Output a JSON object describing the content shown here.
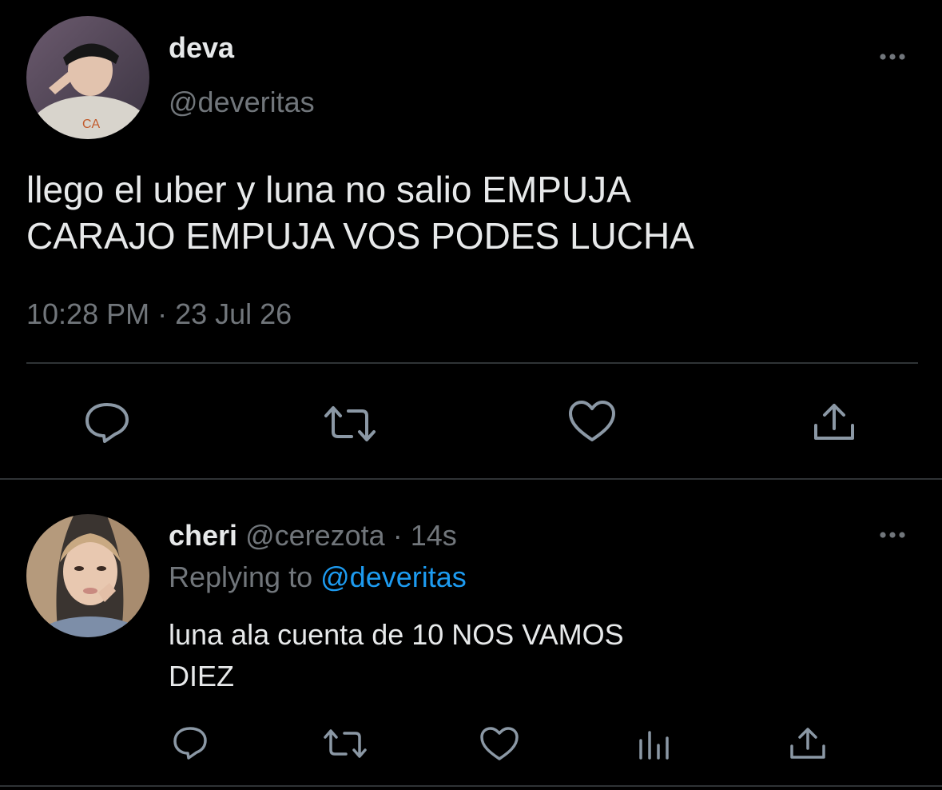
{
  "main_tweet": {
    "display_name": "deva",
    "handle": "@deveritas",
    "text_line1": "llego el uber y luna no salio EMPUJA",
    "text_line2": "CARAJO EMPUJA VOS PODES LUCHA",
    "timestamp": "10:28 PM · 23 Jul 26",
    "actions": [
      "reply-icon",
      "retweet-icon",
      "like-icon",
      "share-icon"
    ]
  },
  "reply": {
    "display_name": "cheri",
    "handle": "@cerezota",
    "time_ago": "· 14s",
    "replying_to_prefix": "Replying to",
    "replying_to_handle": "@deveritas",
    "text_line1": "luna ala cuenta de 10 NOS VAMOS",
    "text_line2": "DIEZ",
    "actions": [
      "reply-icon",
      "retweet-icon",
      "like-icon",
      "analytics-icon",
      "share-icon"
    ]
  },
  "colors": {
    "background": "#000000",
    "text": "#e7e9ea",
    "secondary": "#71767b",
    "link": "#1d9bf0",
    "divider": "#2f3336"
  }
}
